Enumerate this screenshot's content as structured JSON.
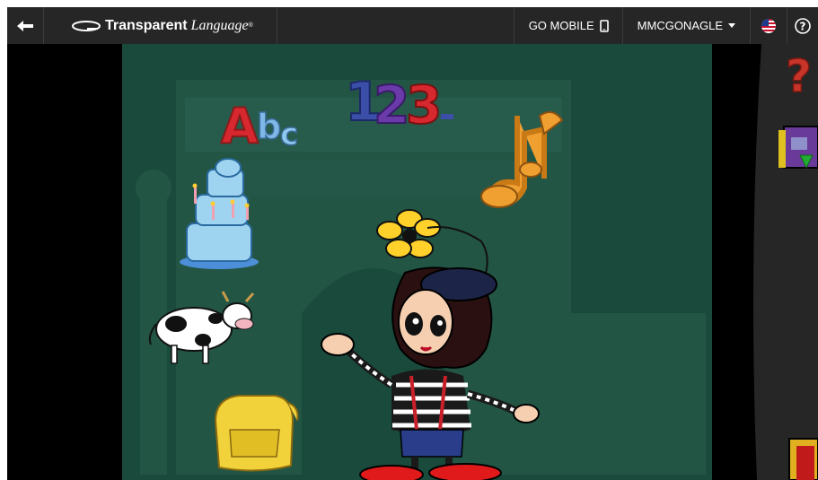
{
  "nav": {
    "brand_bold": "Transparent",
    "brand_italic": "Language",
    "brand_mark": "®",
    "go_mobile_label": "GO MOBILE",
    "user_label": "MMCGONAGLE",
    "help_label": "?"
  },
  "scene": {
    "abc_label": "Abc",
    "numbers_label": "123"
  },
  "icons": {
    "back": "back-arrow-icon",
    "logo": "transparent-language-logo",
    "phone": "phone-icon",
    "caret": "caret-down-icon",
    "flag": "us-flag-icon",
    "help": "help-icon"
  },
  "colors": {
    "topbar": "#262626",
    "scene_bg": "#1a4a3b",
    "help_question": "#c9342a",
    "book_purple": "#6a3a9a",
    "download_green": "#22aa33"
  }
}
